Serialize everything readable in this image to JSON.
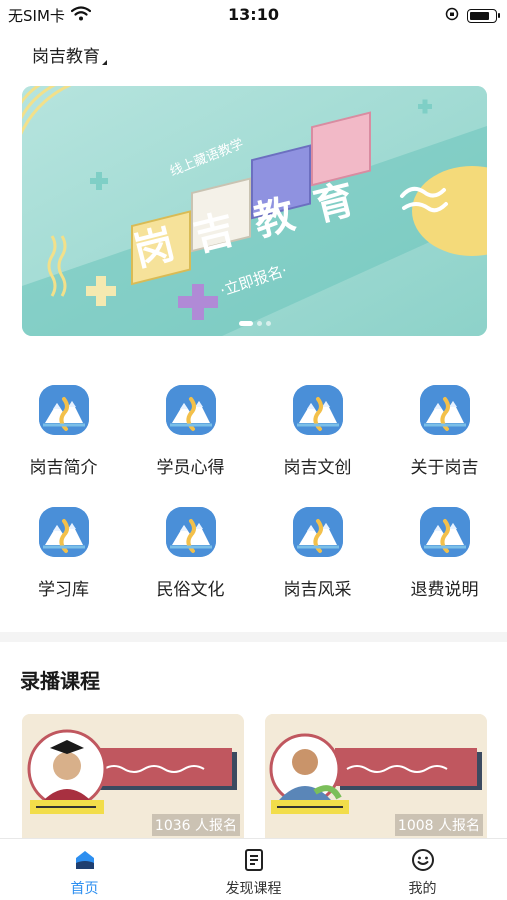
{
  "status_bar": {
    "carrier": "无SIM卡",
    "time": "13:10",
    "wifi_icon": "wifi-icon",
    "orientation_lock_icon": "orientation-lock-icon",
    "battery_icon": "battery-icon",
    "battery_level": 0.8
  },
  "header": {
    "title": "岗吉教育"
  },
  "banner": {
    "headline": "岗吉教育",
    "tagline": "线上藏语教学",
    "cta": "·立即报名·",
    "page_count": 3,
    "active_page": 1
  },
  "grid": {
    "icon_name": "mountain-logo-icon",
    "items": [
      {
        "label": "岗吉简介"
      },
      {
        "label": "学员心得"
      },
      {
        "label": "岗吉文创"
      },
      {
        "label": "关于岗吉"
      },
      {
        "label": "学习库"
      },
      {
        "label": "民俗文化"
      },
      {
        "label": "岗吉风采"
      },
      {
        "label": "退费说明"
      }
    ]
  },
  "recorded_courses": {
    "title": "录播课程",
    "cards": [
      {
        "count": "1036 人报名",
        "thumbnail": "graduate-teacher-portrait"
      },
      {
        "count": "1008 人报名",
        "thumbnail": "teacher-portrait"
      }
    ]
  },
  "tabbar": {
    "tabs": [
      {
        "label": "首页",
        "icon": "home-icon",
        "active": true
      },
      {
        "label": "发现课程",
        "icon": "course-list-icon",
        "active": false
      },
      {
        "label": "我的",
        "icon": "smiley-profile-icon",
        "active": false
      }
    ]
  },
  "colors": {
    "accent": "#2d8ff0",
    "grid_icon_bg": "#4a8fd8",
    "banner_bg": "#a5ddd6"
  }
}
